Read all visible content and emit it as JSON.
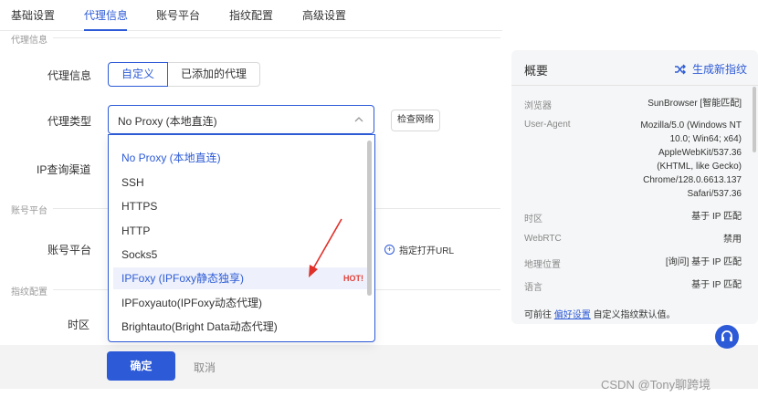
{
  "tabs": [
    "基础设置",
    "代理信息",
    "账号平台",
    "指纹配置",
    "高级设置"
  ],
  "sections": {
    "proxy": "代理信息",
    "account": "账号平台",
    "fingerprint": "指纹配置"
  },
  "form": {
    "proxy_info_label": "代理信息",
    "proxy_mode_options": [
      "自定义",
      "已添加的代理"
    ],
    "proxy_type_label": "代理类型",
    "proxy_type_value": "No Proxy (本地直连)",
    "check_network": "检查网络",
    "ip_channel_label": "IP查询渠道",
    "account_platform_label": "账号平台",
    "open_url": "指定打开URL",
    "timezone_label": "时区"
  },
  "dropdown": {
    "items": [
      "No Proxy (本地直连)",
      "SSH",
      "HTTPS",
      "HTTP",
      "Socks5",
      "IPFoxy (IPFoxy静态独享)",
      "IPFoxyauto(IPFoxy动态代理)",
      "Brightauto(Bright Data动态代理)"
    ],
    "hot_badge": "HOT!"
  },
  "footer": {
    "ok": "确定",
    "cancel": "取消"
  },
  "panel": {
    "title": "概要",
    "action": "生成新指纹",
    "rows": [
      {
        "key": "浏览器",
        "value": "SunBrowser [智能匹配]"
      },
      {
        "key": "User-Agent",
        "value": "Mozilla/5.0 (Windows NT 10.0; Win64; x64) AppleWebKit/537.36 (KHTML, like Gecko) Chrome/128.0.6613.137 Safari/537.36"
      },
      {
        "key": "时区",
        "value": "基于 IP 匹配"
      },
      {
        "key": "WebRTC",
        "value": "禁用"
      },
      {
        "key": "地理位置",
        "value": "[询问] 基于 IP 匹配"
      },
      {
        "key": "语言",
        "value": "基于 IP 匹配"
      }
    ],
    "foot_prefix": "可前往",
    "foot_link": "偏好设置",
    "foot_suffix": "自定义指纹默认值。"
  },
  "watermark": "CSDN @Tony聊跨境",
  "colors": {
    "accent": "#2d5bd7",
    "hot": "#e0403a"
  }
}
